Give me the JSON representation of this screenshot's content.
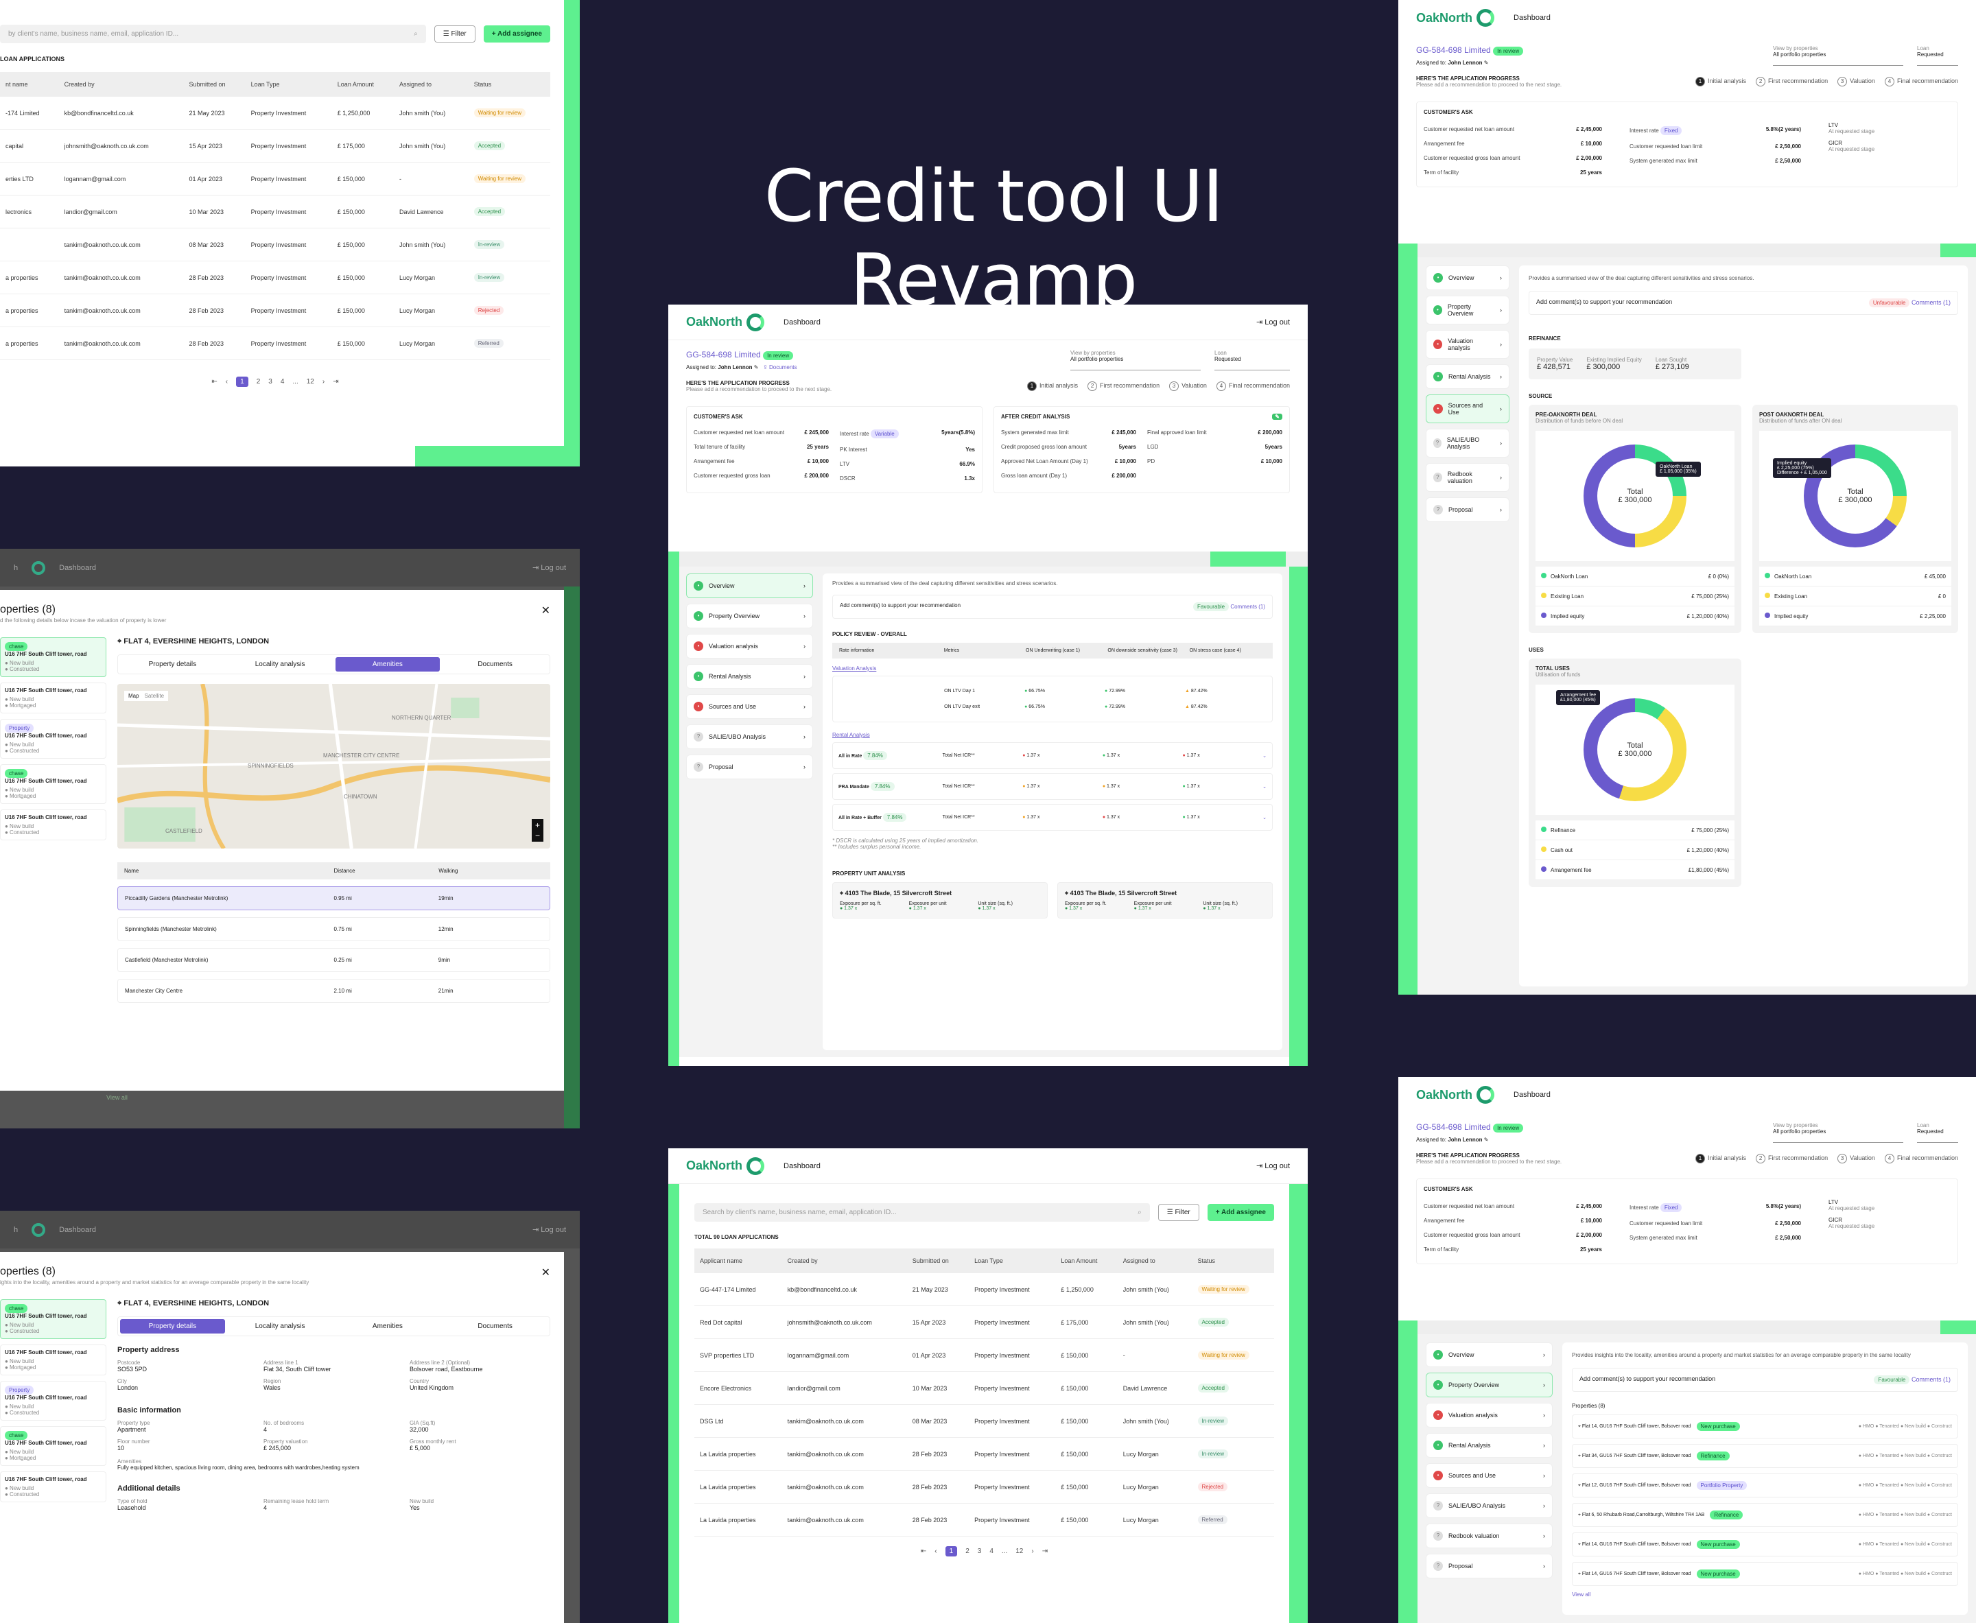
{
  "hero": {
    "title": "Credit tool UI Revamp"
  },
  "brand": {
    "name": "OakNorth",
    "dashboard": "Dashboard",
    "logout": "Log out"
  },
  "app": {
    "id": "GG-584-698 Limited",
    "status": "In review",
    "assigned_label": "Assigned to:",
    "assignee": "John Lennon",
    "documents": "Documents",
    "view_label": "View by properties",
    "view_value": "All portfolio properties",
    "loan_label": "Loan",
    "loan_value": "Requested"
  },
  "progress": {
    "title": "HERE'S THE APPLICATION PROGRESS",
    "sub": "Please add a recommendation to proceed to the next stage.",
    "steps": [
      "Initial analysis",
      "First recommendation",
      "Valuation",
      "Final recommendation"
    ]
  },
  "ask": {
    "title": "CUSTOMER'S ASK",
    "rows": [
      [
        "Customer requested net loan amount",
        "£ 245,000"
      ],
      [
        "Total tenure of facility",
        "25 years"
      ],
      [
        "Arrangement fee",
        "£ 10,000"
      ],
      [
        "Customer requested gross loan",
        "£ 200,000"
      ]
    ],
    "rows2": [
      [
        "Interest rate",
        "Variable",
        "5years(5.8%)"
      ],
      [
        "PK Interest",
        "",
        "Yes"
      ],
      [
        "LTV",
        "",
        "66.9%"
      ],
      [
        "DSCR",
        "",
        "1.3x"
      ]
    ]
  },
  "after": {
    "title": "AFTER CREDIT ANALYSIS",
    "rows": [
      [
        "System generated max limit",
        "£ 245,000"
      ],
      [
        "Credit proposed gross loan amount",
        "5years"
      ],
      [
        "Approved Net Loan Amount (Day 1)",
        "£ 10,000"
      ],
      [
        "Gross loan amount (Day 1)",
        "£ 200,000"
      ]
    ],
    "rows2": [
      [
        "Final approved loan limit",
        "£ 200,000"
      ],
      [
        "LGD",
        "5years"
      ],
      [
        "PD",
        "£ 10,000"
      ]
    ]
  },
  "nav": [
    "Overview",
    "Property Overview",
    "Valuation analysis",
    "Rental Analysis",
    "Sources and Use",
    "SALIE/UBO Analysis",
    "Proposal"
  ],
  "nav_right": [
    "Overview",
    "Property Overview",
    "Valuation analysis",
    "Rental Analysis",
    "Sources and Use",
    "SALIE/UBO Analysis",
    "Redbook valuation",
    "Proposal"
  ],
  "overview": {
    "info": "Provides a summarised view of the deal capturing different sensitivities and stress scenarios.",
    "comment": "Add comment(s) to support your recommendation",
    "fav": "Favourable",
    "unfav": "Unfavourable",
    "comments": "Comments (1)",
    "policy": "POLICY REVIEW - OVERALL",
    "cols": [
      "Rate information",
      "Metrics",
      "ON Underwriting (case 1)",
      "ON downside sensitivity (case 3)",
      "ON stress case (case 4)"
    ],
    "valuation_link": "Valuation Analysis",
    "rental_link": "Rental Analysis",
    "val_rows": [
      [
        "ON LTV Day 1",
        "66.75%",
        "72.99%",
        "87.42%"
      ],
      [
        "ON LTV Day exit",
        "66.75%",
        "72.99%",
        "87.42%"
      ]
    ],
    "rent_rows": [
      [
        "All in Rate",
        "7.84%",
        "Total Net ICR**",
        "1.37 x",
        "1.37 x",
        "1.37 x"
      ],
      [
        "PRA Mandate",
        "7.84%",
        "Total Net ICR**",
        "1.37 x",
        "1.37 x",
        "1.37 x"
      ],
      [
        "All in Rate + Buffer",
        "7.84%",
        "Total Net ICR**",
        "1.37 x",
        "1.37 x",
        "1.37 x"
      ]
    ],
    "notes": [
      "* DSCR is calculated using 25 years of implied amortization.",
      "** Includes surplus personal income."
    ],
    "unit_title": "PROPERTY UNIT ANALYSIS",
    "units": [
      "4103 The Blade, 15 Silvercroft Street",
      "4103 The Blade, 15 Silvercroft Street"
    ],
    "unit_cols": [
      "Exposure per sq. ft.",
      "Exposure per unit",
      "Unit size (sq. ft.)"
    ],
    "unit_val": "1.37 x"
  },
  "list": {
    "search": "Search by client's name, business name, email, application ID...",
    "search_short": "by client's name, business name, email, application ID...",
    "filter": "Filter",
    "add": "Add assignee",
    "total": "TOTAL 90 LOAN APPLICATIONS",
    "total_short": "LOAN APPLICATIONS",
    "cols": [
      "Applicant name",
      "Created by",
      "Submitted on",
      "Loan Type",
      "Loan Amount",
      "Assigned to",
      "Status"
    ],
    "cols_short": [
      "nt name",
      "Created by",
      "Submitted on",
      "Loan Type",
      "Loan Amount",
      "Assigned to",
      "Status"
    ],
    "rows": [
      [
        "GG-447-174 Limited",
        "kb@bondfinanceltd.co.uk",
        "21 May 2023",
        "Property Investment",
        "£ 1,250,000",
        "John smith (You)",
        "Waiting for review"
      ],
      [
        "Red Dot capital",
        "johnsmith@oaknoth.co.uk.com",
        "15 Apr 2023",
        "Property Investment",
        "£ 175,000",
        "John smith (You)",
        "Accepted"
      ],
      [
        "SVP properties LTD",
        "logannam@gmail.com",
        "01 Apr 2023",
        "Property Investment",
        "£ 150,000",
        "-",
        "Waiting for review"
      ],
      [
        "Encore Electronics",
        "landior@gmail.com",
        "10 Mar 2023",
        "Property Investment",
        "£ 150,000",
        "David Lawrence",
        "Accepted"
      ],
      [
        "DSG Ltd",
        "tankim@oaknoth.co.uk.com",
        "08 Mar 2023",
        "Property Investment",
        "£ 150,000",
        "John smith (You)",
        "In-review"
      ],
      [
        "La Lavida properties",
        "tankim@oaknoth.co.uk.com",
        "28 Feb 2023",
        "Property Investment",
        "£ 150,000",
        "Lucy Morgan",
        "In-review"
      ],
      [
        "La Lavida properties",
        "tankim@oaknoth.co.uk.com",
        "28 Feb 2023",
        "Property Investment",
        "£ 150,000",
        "Lucy Morgan",
        "Rejected"
      ],
      [
        "La Lavida properties",
        "tankim@oaknoth.co.uk.com",
        "28 Feb 2023",
        "Property Investment",
        "£ 150,000",
        "Lucy Morgan",
        "Referred"
      ]
    ],
    "rows_short": [
      [
        "-174 Limited",
        "kb@bondfinanceltd.co.uk",
        "21 May 2023",
        "Property Investment",
        "£ 1,250,000",
        "John smith (You)",
        "Waiting for review"
      ],
      [
        "capital",
        "johnsmith@oaknoth.co.uk.com",
        "15 Apr 2023",
        "Property Investment",
        "£ 175,000",
        "John smith (You)",
        "Accepted"
      ],
      [
        "erties LTD",
        "logannam@gmail.com",
        "01 Apr 2023",
        "Property Investment",
        "£ 150,000",
        "-",
        "Waiting for review"
      ],
      [
        "lectronics",
        "landior@gmail.com",
        "10 Mar 2023",
        "Property Investment",
        "£ 150,000",
        "David Lawrence",
        "Accepted"
      ],
      [
        "",
        "tankim@oaknoth.co.uk.com",
        "08 Mar 2023",
        "Property Investment",
        "£ 150,000",
        "John smith (You)",
        "In-review"
      ],
      [
        "a properties",
        "tankim@oaknoth.co.uk.com",
        "28 Feb 2023",
        "Property Investment",
        "£ 150,000",
        "Lucy Morgan",
        "In-review"
      ],
      [
        "a properties",
        "tankim@oaknoth.co.uk.com",
        "28 Feb 2023",
        "Property Investment",
        "£ 150,000",
        "Lucy Morgan",
        "Rejected"
      ],
      [
        "a properties",
        "tankim@oaknoth.co.uk.com",
        "28 Feb 2023",
        "Property Investment",
        "£ 150,000",
        "Lucy Morgan",
        "Referred"
      ]
    ],
    "pages": [
      "1",
      "2",
      "3",
      "4",
      "...",
      "12"
    ]
  },
  "right_ask": {
    "rows": [
      [
        "Customer requested net loan amount",
        "£ 2,45,000"
      ],
      [
        "Arrangement fee",
        "£ 10,000"
      ],
      [
        "Customer requested gross loan amount",
        "£ 2,00,000"
      ],
      [
        "Term of facility",
        "25 years"
      ]
    ],
    "rows2": [
      [
        "Interest rate",
        "Fixed",
        "5.8%(2 years)"
      ],
      [
        "Customer requested loan limit",
        "",
        "£ 2,50,000"
      ],
      [
        "System generated max limit",
        "",
        "£ 2,50,000"
      ]
    ],
    "ltv": "LTV",
    "gcr": "GICR",
    "asreq": "At requested stage"
  },
  "sources": {
    "refinance": "REFINANCE",
    "pv_l": "Property Value",
    "pv": "£ 428,571",
    "eq_l": "Existing Implied Equity",
    "eq": "£ 300,000",
    "ls_l": "Loan Sought",
    "ls": "£ 273,109",
    "source": "SOURCE",
    "pre": "PRE-OAKNORTH DEAL",
    "pre_sub": "Distribution of funds before ON deal",
    "post": "POST OAKNORTH DEAL",
    "post_sub": "Distribution of funds after ON deal",
    "total": "Total",
    "total_val": "£ 300,000",
    "pre_leg": [
      [
        "OakNorth Loan",
        "£ 0",
        "(0%)"
      ],
      [
        "Existing Loan",
        "£ 75,000",
        "(25%)"
      ],
      [
        "Implied equity",
        "£ 1,20,000",
        "(40%)"
      ]
    ],
    "post_leg": [
      [
        "OakNorth Loan",
        "£ 45,000"
      ],
      [
        "Existing Loan",
        "£ 0"
      ],
      [
        "Implied equity",
        "£ 2,25,000"
      ]
    ],
    "tip1": "OakNorth Loan",
    "tip1v": "£ 1,05,000 (35%)",
    "tip2": "Implied equity",
    "tip2v": "£ 2,25,000 (75%)",
    "tip2d": "Difference",
    "tip2dv": "+ £ 1,05,000",
    "uses": "USES",
    "total_uses": "TOTAL USES",
    "uses_sub": "Utilisation of funds",
    "tip3": "Arrangement fee",
    "tip3v": "£1,80,000 (45%)",
    "uses_leg": [
      [
        "Refinance",
        "£ 75,000",
        "(25%)"
      ],
      [
        "Cash out",
        "£ 1,20,000",
        "(40%)"
      ],
      [
        "Arrangement fee",
        "£1,80,000",
        "(45%)"
      ]
    ]
  },
  "props_modal": {
    "title": "operties (8)",
    "sub1": "d the following details below incase the valuation of property is lower",
    "sub2": "ights into the locality, amenities around a property and market statistics for an average comparable property in the same locality",
    "address": "FLAT 4, EVERSHINE HEIGHTS, LONDON",
    "tabs": [
      "Property details",
      "Locality analysis",
      "Amenities",
      "Documents"
    ],
    "prop_name": "U16 7HF South Cliff tower, road",
    "new_build": "New build",
    "constructed": "Constructed",
    "mortgaged": "Mortgaged",
    "purchase": "chase",
    "property": "Property",
    "gage": "gage",
    "ated": "ated",
    "amen_cols": [
      "Name",
      "Distance",
      "Walking"
    ],
    "amen": [
      [
        "Piccadilly Gardens (Manchester Metrolink)",
        "0.95 mi",
        "19min"
      ],
      [
        "Spinningfields (Manchester Metrolink)",
        "0.75 mi",
        "12min"
      ],
      [
        "Castlefield (Manchester Metrolink)",
        "0.25 mi",
        "9min"
      ],
      [
        "Manchester City Centre",
        "2.10 mi",
        "21min"
      ]
    ],
    "map_tabs": [
      "Map",
      "Satellite"
    ],
    "map_labels": [
      "NORTHERN QUARTER",
      "MANCHESTER CITY CENTRE",
      "SPINNINGFIELDS",
      "CHINATOWN",
      "CANAL STREET",
      "CASTLEFIELD",
      "Piccadilly Gardens",
      "Leonardo Hotel Manchester Central",
      "Manchester Piccadilly"
    ],
    "view_all": "View all",
    "addr_h": "Property address",
    "fields": [
      [
        "Postcode",
        "SO53 5PD"
      ],
      [
        "Address line 1",
        "Flat 34, South Cliff tower"
      ],
      [
        "Address line 2 (Optional)",
        "Bolsover road, Eastbourne"
      ],
      [
        "City",
        "London"
      ],
      [
        "Region",
        "Wales"
      ],
      [
        "Country",
        "United Kingdom"
      ]
    ],
    "basic_h": "Basic information",
    "basic": [
      [
        "Property type",
        "Apartment"
      ],
      [
        "No. of bedrooms",
        "4"
      ],
      [
        "GIA (Sq.ft)",
        "32,000"
      ],
      [
        "Floor number",
        "10"
      ],
      [
        "Property valuation",
        "£ 245,000"
      ],
      [
        "Gross monthly rent",
        "£ 5,000"
      ]
    ],
    "amenities_l": "Amenities",
    "amenities_v": "Fully equipped kitchen, spacious living room, dining area, bedrooms with wardrobes,heating system",
    "add_h": "Additional details",
    "add": [
      [
        "Type of hold",
        "Leasehold"
      ],
      [
        "Remaining lease hold term",
        "4"
      ],
      [
        "New build",
        "Yes"
      ]
    ]
  },
  "prop_overview": {
    "info": "Provides insights into the locality, amenities around a property and market statistics for an average comparable property in the same locality",
    "heading": "Properties (8)",
    "rows": [
      [
        "Flat 14, GU16 7HF South Cliff tower, Bolsover road",
        "New purchase"
      ],
      [
        "Flat 34, GU16 7HF South Cliff tower, Bolsover road",
        "Refinance"
      ],
      [
        "Flat 12, GU16 7HF South Cliff tower, Bolsover road",
        "Portfolio Property"
      ],
      [
        "Flat 6, 50 Rhubarb Road,Carroltburgh, Wiltshire TR4 1AB",
        "Refinance"
      ],
      [
        "Flat 14, GU16 7HF South Cliff tower, Bolsover road",
        "New purchase"
      ],
      [
        "Flat 14, GU16 7HF South Cliff tower, Bolsover road",
        "New purchase"
      ]
    ],
    "tags": [
      "HMO",
      "Tenanted",
      "New build",
      "Construct"
    ],
    "mortgaged": "Mortgaged",
    "view_all": "View all"
  }
}
